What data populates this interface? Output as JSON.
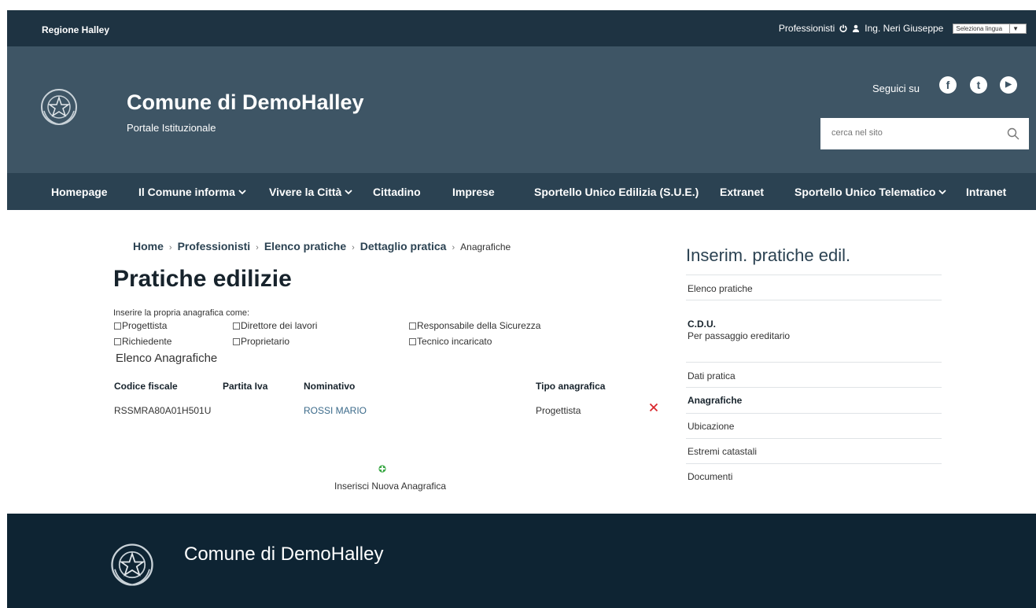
{
  "topbar": {
    "region": "Regione Halley",
    "professionisti": "Professionisti",
    "user": "Ing. Neri Giuseppe",
    "language": "Seleziona lingua",
    "language_arrow": "▼"
  },
  "header": {
    "title": "Comune di DemoHalley",
    "subtitle": "Portale Istituzionale",
    "follow": "Seguici su",
    "social": [
      "f",
      "t",
      "▶"
    ],
    "search_placeholder": "cerca nel sito"
  },
  "nav": {
    "items": [
      "Homepage",
      "Il Comune informa",
      "Vivere la Città",
      "Cittadino",
      "Imprese",
      "Sportello Unico Edilizia (S.U.E.)",
      "Extranet",
      "Sportello Unico Telematico",
      "Intranet"
    ]
  },
  "breadcrumb": {
    "items": [
      "Home",
      "Professionisti",
      "Elenco pratiche",
      "Dettaglio pratica"
    ],
    "current": "Anagrafiche",
    "separator": "›"
  },
  "main": {
    "title": "Pratiche edilizie",
    "intro": "Inserire la propria anagrafica come:",
    "checkboxes": [
      "Progettista",
      "Direttore dei lavori",
      "Responsabile della Sicurezza",
      "Richiedente",
      "Proprietario",
      "Tecnico incaricato"
    ],
    "list_title": "Elenco Anagrafiche",
    "table": {
      "headers": [
        "Codice fiscale",
        "Partita Iva",
        "Nominativo",
        "Tipo anagrafica"
      ],
      "rows": [
        {
          "codice_fiscale": "RSSMRA80A01H501U",
          "partita_iva": "",
          "nominativo": "ROSSI MARIO",
          "tipo": "Progettista"
        }
      ]
    },
    "new_label": "Inserisci Nuova Anagrafica"
  },
  "sidebar": {
    "title": "Inserim. pratiche edil.",
    "elenco": "Elenco pratiche",
    "cdu_title": "C.D.U.",
    "cdu_sub": "Per passaggio ereditario",
    "items": [
      "Dati pratica",
      "Anagrafiche",
      "Ubicazione",
      "Estremi catastali",
      "Documenti"
    ]
  },
  "footer": {
    "title": "Comune di DemoHalley"
  },
  "colors": {
    "topbar": "#1e3342",
    "header": "#3e5565",
    "nav": "#2b4252",
    "footer": "#0e2433",
    "delete": "#d9262c",
    "add": "#3aa845"
  },
  "icons": [
    "power-icon",
    "user-icon",
    "facebook-icon",
    "twitter-icon",
    "youtube-icon",
    "search-icon",
    "chevron-down-icon",
    "delete-icon",
    "add-icon",
    "emblem-logo"
  ]
}
